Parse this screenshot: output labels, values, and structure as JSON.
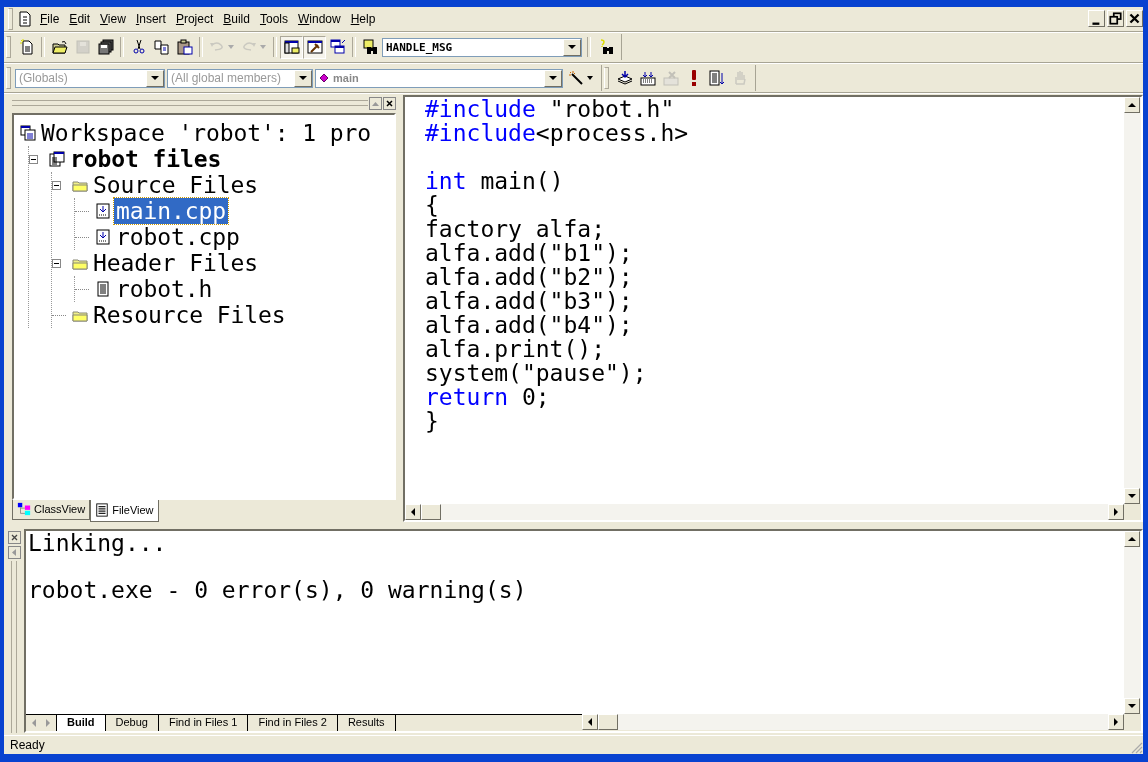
{
  "menu_bar": {
    "items": [
      "File",
      "Edit",
      "View",
      "Insert",
      "Project",
      "Build",
      "Tools",
      "Window",
      "Help"
    ]
  },
  "toolbar_standard": [
    {
      "kind": "new-file",
      "disabled": false
    },
    {
      "kind": "sep"
    },
    {
      "kind": "open",
      "disabled": false
    },
    {
      "kind": "save",
      "disabled": true
    },
    {
      "kind": "save-all",
      "disabled": false
    },
    {
      "kind": "sep"
    },
    {
      "kind": "cut",
      "disabled": false
    },
    {
      "kind": "copy",
      "disabled": false
    },
    {
      "kind": "paste",
      "disabled": false
    },
    {
      "kind": "sep"
    },
    {
      "kind": "undo",
      "disabled": true
    },
    {
      "kind": "redo",
      "disabled": true
    },
    {
      "kind": "sep"
    },
    {
      "kind": "workspace",
      "disabled": false,
      "pressed": true
    },
    {
      "kind": "output",
      "disabled": false,
      "pressed": true
    },
    {
      "kind": "window-list",
      "disabled": false,
      "pressed": false
    },
    {
      "kind": "sep"
    },
    {
      "kind": "find-in-files",
      "disabled": false
    }
  ],
  "find_combo": {
    "value": "HANDLE_MSG"
  },
  "toolbar_wizard": {
    "class_combo": {
      "value": "(Globals)",
      "disabled": true
    },
    "members_combo": {
      "value": "(All global members)",
      "disabled": true
    },
    "function_combo": {
      "value": "main",
      "disabled": false
    }
  },
  "toolbar_build": [
    {
      "kind": "compile",
      "disabled": false
    },
    {
      "kind": "build",
      "disabled": false
    },
    {
      "kind": "stop-build",
      "disabled": true
    },
    {
      "kind": "execute",
      "disabled": false
    },
    {
      "kind": "go",
      "disabled": false
    },
    {
      "kind": "breakpoint",
      "disabled": true
    }
  ],
  "workspace": {
    "tree": [
      {
        "label": "Workspace 'robot': 1 pro",
        "kind": "workspace",
        "bold": false,
        "selected": false,
        "children": [
          {
            "label": "robot files",
            "kind": "project",
            "bold": true,
            "selected": false,
            "expanded": true,
            "children": [
              {
                "label": "Source Files",
                "kind": "folder",
                "bold": false,
                "selected": false,
                "expanded": true,
                "children": [
                  {
                    "label": "main.cpp",
                    "kind": "source",
                    "bold": false,
                    "selected": true
                  },
                  {
                    "label": "robot.cpp",
                    "kind": "source",
                    "bold": false,
                    "selected": false
                  }
                ]
              },
              {
                "label": "Header Files",
                "kind": "folder",
                "bold": false,
                "selected": false,
                "expanded": true,
                "children": [
                  {
                    "label": "robot.h",
                    "kind": "header",
                    "bold": false,
                    "selected": false
                  }
                ]
              },
              {
                "label": "Resource Files",
                "kind": "folder",
                "bold": false,
                "selected": false
              }
            ]
          }
        ]
      }
    ],
    "tabs": [
      {
        "label": "ClassView",
        "kind": "classes",
        "selected": false
      },
      {
        "label": "FileView",
        "kind": "files",
        "selected": true
      }
    ]
  },
  "editor": {
    "lines": [
      {
        "segments": [
          {
            "kind": "keyword",
            "text": "#include"
          },
          {
            "kind": "plain",
            "text": " \"robot.h\""
          }
        ]
      },
      {
        "segments": [
          {
            "kind": "keyword",
            "text": "#include"
          },
          {
            "kind": "plain",
            "text": "<process.h>"
          }
        ]
      },
      {
        "space_before": true,
        "segments": [
          {
            "kind": "keyword",
            "text": "int"
          },
          {
            "kind": "plain",
            "text": " main()"
          }
        ]
      },
      {
        "segments": [
          {
            "kind": "plain",
            "text": "{"
          }
        ]
      },
      {
        "segments": [
          {
            "kind": "plain",
            "text": "factory alfa;"
          }
        ]
      },
      {
        "segments": [
          {
            "kind": "plain",
            "text": "alfa.add(\"b1\");"
          }
        ]
      },
      {
        "segments": [
          {
            "kind": "plain",
            "text": "alfa.add(\"b2\");"
          }
        ]
      },
      {
        "segments": [
          {
            "kind": "plain",
            "text": "alfa.add(\"b3\");"
          }
        ]
      },
      {
        "segments": [
          {
            "kind": "plain",
            "text": "alfa.add(\"b4\");"
          }
        ]
      },
      {
        "segments": [
          {
            "kind": "plain",
            "text": "alfa.print();"
          }
        ]
      },
      {
        "segments": [
          {
            "kind": "plain",
            "text": "system(\"pause\");"
          }
        ]
      },
      {
        "segments": [
          {
            "kind": "keyword",
            "text": "return"
          },
          {
            "kind": "plain",
            "text": " 0;"
          }
        ]
      },
      {
        "segments": [
          {
            "kind": "plain",
            "text": "}"
          }
        ]
      }
    ]
  },
  "output": {
    "lines": [
      {
        "text": "Linking...",
        "space_before": false
      },
      {
        "text": "robot.exe - 0 error(s), 0 warning(s)",
        "space_before": true
      }
    ],
    "tabs": [
      {
        "label": "Build",
        "selected": true
      },
      {
        "label": "Debug",
        "selected": false
      },
      {
        "label": "Find in Files 1",
        "selected": false
      },
      {
        "label": "Find in Files 2",
        "selected": false
      },
      {
        "label": "Results",
        "selected": false
      }
    ]
  },
  "status_bar": {
    "text": "Ready"
  }
}
